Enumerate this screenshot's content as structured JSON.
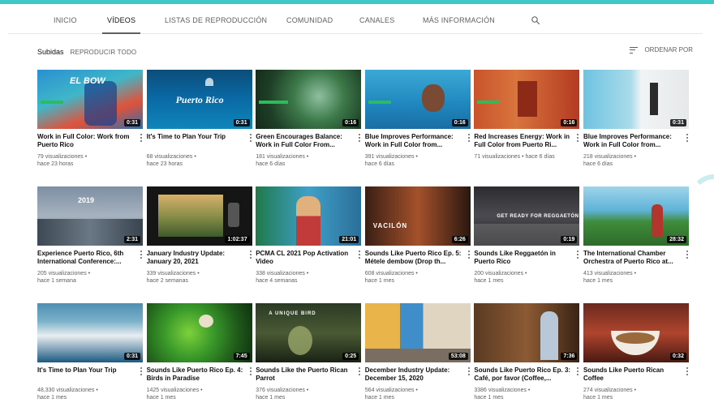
{
  "tabs": [
    "INICIO",
    "VÍDEOS",
    "LISTAS DE REPRODUCCIÓN",
    "COMUNIDAD",
    "CANALES",
    "MÁS INFORMACIÓN"
  ],
  "section": {
    "title": "Subidas",
    "play_all": "REPRODUCIR TODO",
    "sort": "ORDENAR POR"
  },
  "videos": [
    {
      "title": "Work in Full Color: Work from Puerto Rico",
      "views": "79 visualizaciones •",
      "age": "hace 23 horas",
      "duration": "0:31",
      "overlay": "EL BOW"
    },
    {
      "title": "It's Time to Plan Your Trip",
      "views": "68 visualizaciones •",
      "age": "hace 23 horas",
      "duration": "0:31",
      "overlay": "Puerto Rico"
    },
    {
      "title": "Green Encourages Balance: Work in Full Color From...",
      "views": "181 visualizaciones •",
      "age": "hace 6 días",
      "duration": "0:16",
      "overlay": ""
    },
    {
      "title": "Blue Improves Performance: Work in Full Color from...",
      "views": "391 visualizaciones •",
      "age": "hace 6 días",
      "duration": "0:16",
      "overlay": ""
    },
    {
      "title": "Red Increases Energy: Work in Full Color from Puerto Ri...",
      "views": "71 visualizaciones • hace 6 días",
      "age": "",
      "duration": "0:16",
      "overlay": ""
    },
    {
      "title": "Blue Improves Performance: Work in Full Color from...",
      "views": "218 visualizaciones •",
      "age": "hace 6 días",
      "duration": "0:31",
      "overlay": ""
    },
    {
      "title": "Experience Puerto Rico, 6th International Conference:...",
      "views": "205 visualizaciones •",
      "age": "hace 1 semana",
      "duration": "2:31",
      "overlay": "2019"
    },
    {
      "title": "January Industry Update: January 20, 2021",
      "views": "339 visualizaciones •",
      "age": "hace 2 semanas",
      "duration": "1:02:37",
      "overlay": ""
    },
    {
      "title": "PCMA CL 2021 Pop Activation Video",
      "views": "338 visualizaciones •",
      "age": "hace 4 semanas",
      "duration": "21:01",
      "overlay": ""
    },
    {
      "title": "Sounds Like Puerto Rico Ep. 5: Métele dembow (Drop th...",
      "views": "608 visualizaciones •",
      "age": "hace 1 mes",
      "duration": "6:26",
      "overlay": "VACILÓN"
    },
    {
      "title": "Sounds Like Reggaetón in Puerto Rico",
      "views": "200 visualizaciones •",
      "age": "hace 1 mes",
      "duration": "0:19",
      "overlay": "GET READY FOR REGGAETÓN"
    },
    {
      "title": "The International Chamber Orchestra of Puerto Rico at...",
      "views": "413 visualizaciones •",
      "age": "hace 1 mes",
      "duration": "28:32",
      "overlay": ""
    },
    {
      "title": "It's Time to Plan Your Trip",
      "views": "48,330 visualizaciones •",
      "age": "hace 1 mes",
      "duration": "0:31",
      "overlay": ""
    },
    {
      "title": "Sounds Like Puerto Rico Ep. 4: Birds in Paradise",
      "views": "1425 visualizaciones •",
      "age": "hace 1 mes",
      "duration": "7:45",
      "overlay": ""
    },
    {
      "title": "Sounds Like the Puerto Rican Parrot",
      "views": "376 visualizaciones •",
      "age": "hace 1 mes",
      "duration": "0:25",
      "overlay": "A UNIQUE BIRD"
    },
    {
      "title": "December Industry Update: December 15, 2020",
      "views": "564 visualizaciones •",
      "age": "hace 1 mes",
      "duration": "53:08",
      "overlay": ""
    },
    {
      "title": "Sounds Like Puerto Rico Ep. 3: Café, por favor (Coffee,...",
      "views": "3386 visualizaciones •",
      "age": "hace 1 mes",
      "duration": "7:36",
      "overlay": ""
    },
    {
      "title": "Sounds Like Puerto Rican Coffee",
      "views": "274 visualizaciones •",
      "age": "hace 1 mes",
      "duration": "0:32",
      "overlay": ""
    }
  ],
  "colors": {
    "accent": "#3ec8c8",
    "text": "#0f0f0f",
    "muted": "#606060"
  },
  "icons": {
    "search": "search-icon",
    "sort": "sort-icon",
    "more": "more-vert-icon"
  }
}
